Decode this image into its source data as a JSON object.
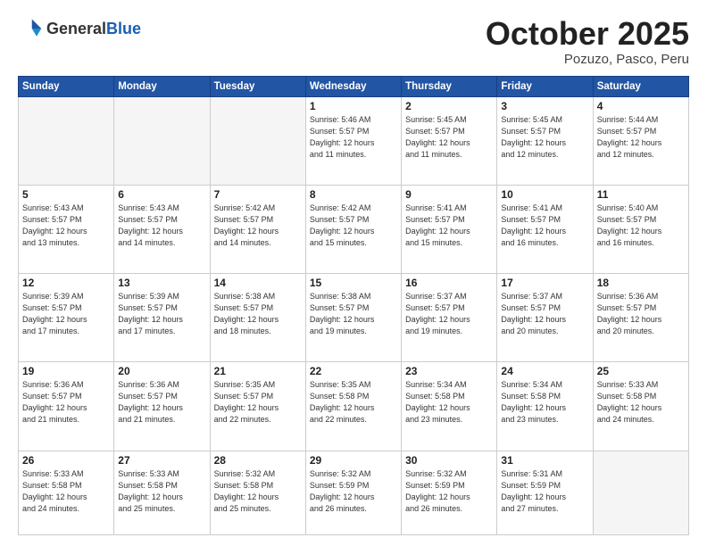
{
  "header": {
    "logo_general": "General",
    "logo_blue": "Blue",
    "month_title": "October 2025",
    "subtitle": "Pozuzo, Pasco, Peru"
  },
  "weekdays": [
    "Sunday",
    "Monday",
    "Tuesday",
    "Wednesday",
    "Thursday",
    "Friday",
    "Saturday"
  ],
  "weeks": [
    [
      {
        "day": "",
        "info": ""
      },
      {
        "day": "",
        "info": ""
      },
      {
        "day": "",
        "info": ""
      },
      {
        "day": "1",
        "info": "Sunrise: 5:46 AM\nSunset: 5:57 PM\nDaylight: 12 hours\nand 11 minutes."
      },
      {
        "day": "2",
        "info": "Sunrise: 5:45 AM\nSunset: 5:57 PM\nDaylight: 12 hours\nand 11 minutes."
      },
      {
        "day": "3",
        "info": "Sunrise: 5:45 AM\nSunset: 5:57 PM\nDaylight: 12 hours\nand 12 minutes."
      },
      {
        "day": "4",
        "info": "Sunrise: 5:44 AM\nSunset: 5:57 PM\nDaylight: 12 hours\nand 12 minutes."
      }
    ],
    [
      {
        "day": "5",
        "info": "Sunrise: 5:43 AM\nSunset: 5:57 PM\nDaylight: 12 hours\nand 13 minutes."
      },
      {
        "day": "6",
        "info": "Sunrise: 5:43 AM\nSunset: 5:57 PM\nDaylight: 12 hours\nand 14 minutes."
      },
      {
        "day": "7",
        "info": "Sunrise: 5:42 AM\nSunset: 5:57 PM\nDaylight: 12 hours\nand 14 minutes."
      },
      {
        "day": "8",
        "info": "Sunrise: 5:42 AM\nSunset: 5:57 PM\nDaylight: 12 hours\nand 15 minutes."
      },
      {
        "day": "9",
        "info": "Sunrise: 5:41 AM\nSunset: 5:57 PM\nDaylight: 12 hours\nand 15 minutes."
      },
      {
        "day": "10",
        "info": "Sunrise: 5:41 AM\nSunset: 5:57 PM\nDaylight: 12 hours\nand 16 minutes."
      },
      {
        "day": "11",
        "info": "Sunrise: 5:40 AM\nSunset: 5:57 PM\nDaylight: 12 hours\nand 16 minutes."
      }
    ],
    [
      {
        "day": "12",
        "info": "Sunrise: 5:39 AM\nSunset: 5:57 PM\nDaylight: 12 hours\nand 17 minutes."
      },
      {
        "day": "13",
        "info": "Sunrise: 5:39 AM\nSunset: 5:57 PM\nDaylight: 12 hours\nand 17 minutes."
      },
      {
        "day": "14",
        "info": "Sunrise: 5:38 AM\nSunset: 5:57 PM\nDaylight: 12 hours\nand 18 minutes."
      },
      {
        "day": "15",
        "info": "Sunrise: 5:38 AM\nSunset: 5:57 PM\nDaylight: 12 hours\nand 19 minutes."
      },
      {
        "day": "16",
        "info": "Sunrise: 5:37 AM\nSunset: 5:57 PM\nDaylight: 12 hours\nand 19 minutes."
      },
      {
        "day": "17",
        "info": "Sunrise: 5:37 AM\nSunset: 5:57 PM\nDaylight: 12 hours\nand 20 minutes."
      },
      {
        "day": "18",
        "info": "Sunrise: 5:36 AM\nSunset: 5:57 PM\nDaylight: 12 hours\nand 20 minutes."
      }
    ],
    [
      {
        "day": "19",
        "info": "Sunrise: 5:36 AM\nSunset: 5:57 PM\nDaylight: 12 hours\nand 21 minutes."
      },
      {
        "day": "20",
        "info": "Sunrise: 5:36 AM\nSunset: 5:57 PM\nDaylight: 12 hours\nand 21 minutes."
      },
      {
        "day": "21",
        "info": "Sunrise: 5:35 AM\nSunset: 5:57 PM\nDaylight: 12 hours\nand 22 minutes."
      },
      {
        "day": "22",
        "info": "Sunrise: 5:35 AM\nSunset: 5:58 PM\nDaylight: 12 hours\nand 22 minutes."
      },
      {
        "day": "23",
        "info": "Sunrise: 5:34 AM\nSunset: 5:58 PM\nDaylight: 12 hours\nand 23 minutes."
      },
      {
        "day": "24",
        "info": "Sunrise: 5:34 AM\nSunset: 5:58 PM\nDaylight: 12 hours\nand 23 minutes."
      },
      {
        "day": "25",
        "info": "Sunrise: 5:33 AM\nSunset: 5:58 PM\nDaylight: 12 hours\nand 24 minutes."
      }
    ],
    [
      {
        "day": "26",
        "info": "Sunrise: 5:33 AM\nSunset: 5:58 PM\nDaylight: 12 hours\nand 24 minutes."
      },
      {
        "day": "27",
        "info": "Sunrise: 5:33 AM\nSunset: 5:58 PM\nDaylight: 12 hours\nand 25 minutes."
      },
      {
        "day": "28",
        "info": "Sunrise: 5:32 AM\nSunset: 5:58 PM\nDaylight: 12 hours\nand 25 minutes."
      },
      {
        "day": "29",
        "info": "Sunrise: 5:32 AM\nSunset: 5:59 PM\nDaylight: 12 hours\nand 26 minutes."
      },
      {
        "day": "30",
        "info": "Sunrise: 5:32 AM\nSunset: 5:59 PM\nDaylight: 12 hours\nand 26 minutes."
      },
      {
        "day": "31",
        "info": "Sunrise: 5:31 AM\nSunset: 5:59 PM\nDaylight: 12 hours\nand 27 minutes."
      },
      {
        "day": "",
        "info": ""
      }
    ]
  ]
}
